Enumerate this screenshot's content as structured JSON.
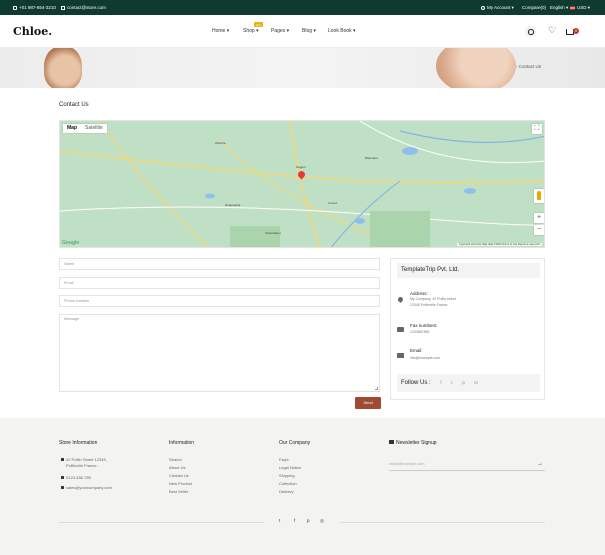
{
  "topbar": {
    "phone": "+01 987-654-3210",
    "email": "contact@store.com",
    "account": "My Account",
    "compare": "Compare(0)",
    "language": "English",
    "currency": "USD"
  },
  "header": {
    "logo": "Chloe.",
    "nav": [
      "Home",
      "Shop",
      "Pages",
      "Blog",
      "Look Book"
    ],
    "badge": "Hot",
    "cart_count": "0"
  },
  "hero": {
    "breadcrumb": "Contact Us"
  },
  "page_title": "Contact Us",
  "map": {
    "tabs": [
      "Map",
      "Satellite"
    ],
    "zoom_in": "+",
    "zoom_out": "−",
    "fullscreen": "⛶",
    "brand": "Google",
    "footer": "Keyboard shortcuts   Map data ©2023   Terms of Use   Report a map error",
    "cities": [
      "Wardha",
      "Hinganghat",
      "Nagpur",
      "Bhandara",
      "Umred",
      "Chandrapur"
    ]
  },
  "form": {
    "name_placeholder": "Name",
    "email_placeholder": "Email",
    "phone_placeholder": "Phone Number",
    "message_placeholder": "Message",
    "send_label": "Send"
  },
  "info": {
    "company": "TemplateTrip Pvt. Ltd.",
    "address_label": "Address:",
    "address_line1": "My Company, 42 Puffin street",
    "address_line2": "12345 Puffinville France",
    "fax_label": "Fax numbers:",
    "fax_value": "1234567890",
    "email_label": "Email:",
    "email_value": "info@example.com",
    "follow_label": "Follow Us :",
    "social": [
      "f",
      "t",
      "p",
      "in"
    ]
  },
  "footer": {
    "store_heading": "Store Information",
    "store_address1": "42 Puffin Street 12345,",
    "store_address2": "Puffinville France.",
    "store_phone": "0123-456-789",
    "store_email": "sales@yourcompany.com",
    "information_heading": "Information",
    "information_links": [
      "Search",
      "About Us",
      "Contact Us",
      "New Product",
      "Best Seller"
    ],
    "company_heading": "Our Company",
    "company_links": [
      "Faq's",
      "Legal Notice",
      "Shipping",
      "Collection",
      "Delivery"
    ],
    "newsletter_heading": "Newsletter Signup",
    "newsletter_placeholder": "email@example.com",
    "social": [
      "t",
      "f",
      "p",
      "◎"
    ]
  }
}
